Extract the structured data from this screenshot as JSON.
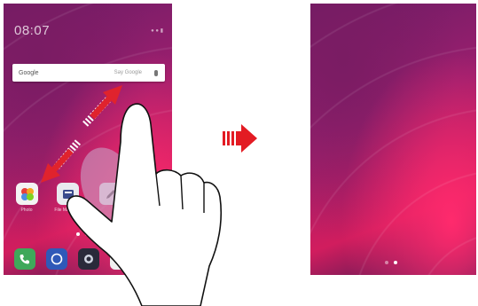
{
  "home_before": {
    "status": {
      "time": "08:07"
    },
    "search_widget": {
      "brand": "Google",
      "placeholder": "Say Google"
    },
    "apps": [
      {
        "label": "Photo",
        "icon": "gallery-icon"
      },
      {
        "label": "File Manager",
        "icon": "file-manager-icon"
      },
      {
        "label": "",
        "icon": "pen-icon"
      }
    ],
    "dock": [
      {
        "icon": "phone-icon"
      },
      {
        "icon": "messages-icon"
      },
      {
        "icon": "camera-icon"
      },
      {
        "icon": "browser-icon"
      }
    ]
  },
  "home_after": {
    "page_indicator": {
      "count": 2,
      "active_index": 1
    }
  },
  "gesture": {
    "type": "pinch-out",
    "icon": "two-finger-hand-icon"
  },
  "transition": {
    "icon": "next-step-arrow-icon"
  },
  "colors": {
    "wallpaper_start": "#6d1c66",
    "wallpaper_mid": "#d11d5e",
    "arrow_red": "#e0232d",
    "transition_red": "#e31b23"
  }
}
